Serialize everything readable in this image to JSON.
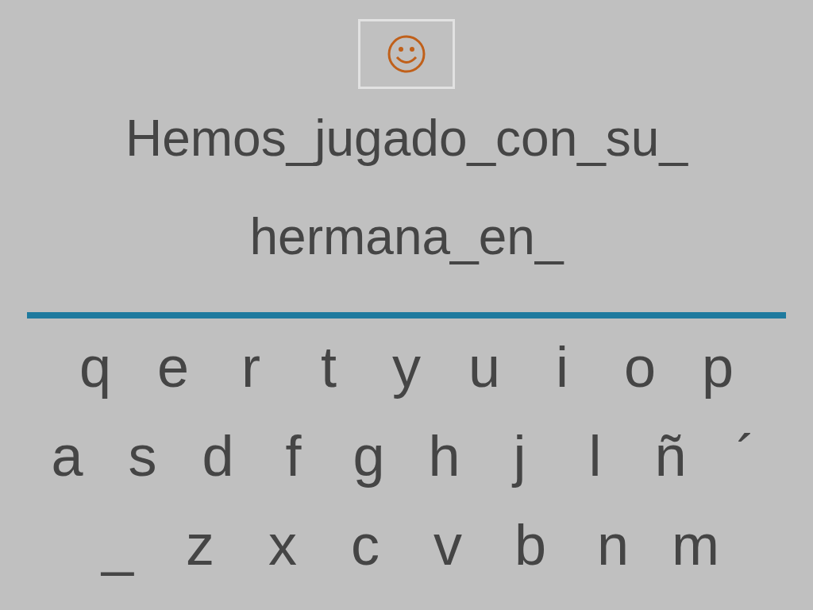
{
  "feedback_button": {
    "kind": "smiley"
  },
  "sentence_lines": [
    "Hemos_jugado_con_su_",
    "hermana_en_"
  ],
  "keyboard_rows": [
    [
      "q",
      "e",
      "r",
      "t",
      "y",
      "u",
      "i",
      "o",
      "p"
    ],
    [
      "a",
      "s",
      "d",
      "f",
      "g",
      "h",
      "j",
      "l",
      "ñ",
      "´"
    ],
    [
      "_",
      "z",
      "x",
      "c",
      "v",
      "b",
      "n",
      "m"
    ]
  ]
}
